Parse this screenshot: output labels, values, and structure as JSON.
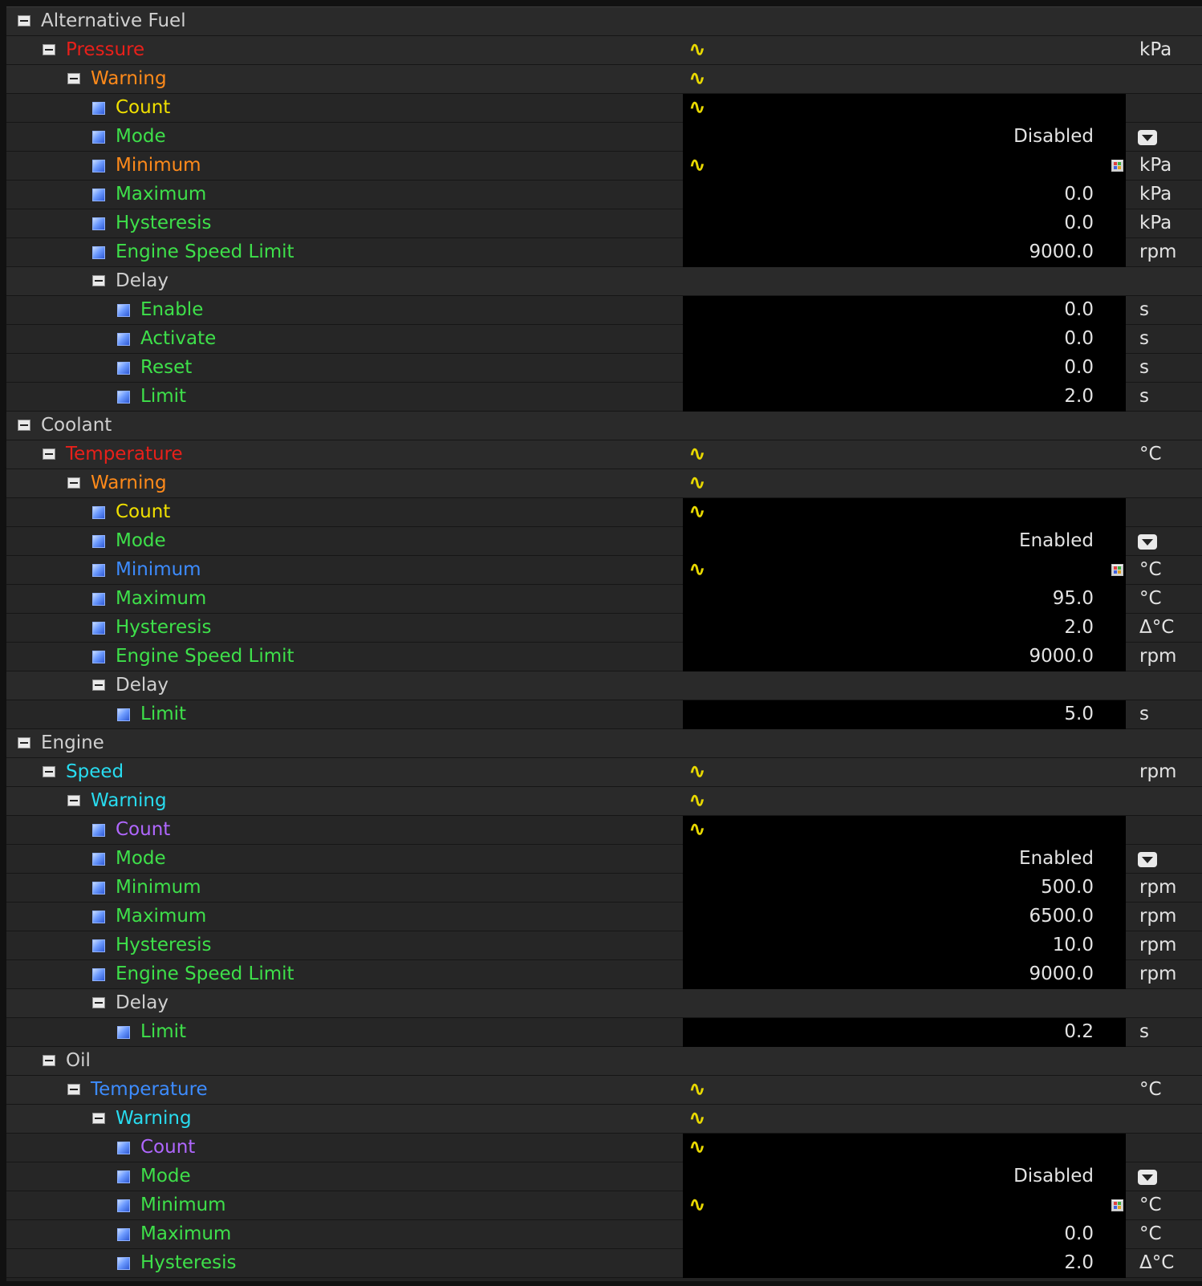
{
  "colors": {
    "red": "#e8201a",
    "orange": "#ff8a1a",
    "yellow": "#f0e000",
    "green": "#3ee04a",
    "blue": "#3d8cff",
    "cyan": "#28dcf0",
    "purple": "#b067ff",
    "gray": "#d0d0d0"
  },
  "rows": [
    {
      "label": "Alternative Fuel",
      "level": 0,
      "kind": "group",
      "color": "gray"
    },
    {
      "label": "Pressure",
      "level": 1,
      "kind": "group",
      "color": "red",
      "wave": true,
      "unit": "kPa"
    },
    {
      "label": "Warning",
      "level": 2,
      "kind": "group",
      "color": "orange",
      "wave": true
    },
    {
      "label": "Count",
      "level": 3,
      "kind": "leaf",
      "color": "yellow",
      "wave": true
    },
    {
      "label": "Mode",
      "level": 3,
      "kind": "leaf",
      "color": "green",
      "value": "Disabled",
      "dropdown": true
    },
    {
      "label": "Minimum",
      "level": 3,
      "kind": "leaf",
      "color": "orange",
      "wave": true,
      "grid": true,
      "unit": "kPa"
    },
    {
      "label": "Maximum",
      "level": 3,
      "kind": "leaf",
      "color": "green",
      "value": "0.0",
      "unit": "kPa"
    },
    {
      "label": "Hysteresis",
      "level": 3,
      "kind": "leaf",
      "color": "green",
      "value": "0.0",
      "unit": "kPa"
    },
    {
      "label": "Engine Speed Limit",
      "level": 3,
      "kind": "leaf",
      "color": "green",
      "value": "9000.0",
      "unit": "rpm"
    },
    {
      "label": "Delay",
      "level": 3,
      "kind": "group",
      "color": "gray"
    },
    {
      "label": "Enable",
      "level": 4,
      "kind": "leaf",
      "color": "green",
      "value": "0.0",
      "unit": "s"
    },
    {
      "label": "Activate",
      "level": 4,
      "kind": "leaf",
      "color": "green",
      "value": "0.0",
      "unit": "s"
    },
    {
      "label": "Reset",
      "level": 4,
      "kind": "leaf",
      "color": "green",
      "value": "0.0",
      "unit": "s"
    },
    {
      "label": "Limit",
      "level": 4,
      "kind": "leaf",
      "color": "green",
      "value": "2.0",
      "unit": "s"
    },
    {
      "label": "Coolant",
      "level": 0,
      "kind": "group",
      "color": "gray"
    },
    {
      "label": "Temperature",
      "level": 1,
      "kind": "group",
      "color": "red",
      "wave": true,
      "unit": "°C"
    },
    {
      "label": "Warning",
      "level": 2,
      "kind": "group",
      "color": "orange",
      "wave": true
    },
    {
      "label": "Count",
      "level": 3,
      "kind": "leaf",
      "color": "yellow",
      "wave": true
    },
    {
      "label": "Mode",
      "level": 3,
      "kind": "leaf",
      "color": "green",
      "value": "Enabled",
      "dropdown": true
    },
    {
      "label": "Minimum",
      "level": 3,
      "kind": "leaf",
      "color": "blue",
      "wave": true,
      "grid": true,
      "unit": "°C"
    },
    {
      "label": "Maximum",
      "level": 3,
      "kind": "leaf",
      "color": "green",
      "value": "95.0",
      "unit": "°C"
    },
    {
      "label": "Hysteresis",
      "level": 3,
      "kind": "leaf",
      "color": "green",
      "value": "2.0",
      "unit": "Δ°C"
    },
    {
      "label": "Engine Speed Limit",
      "level": 3,
      "kind": "leaf",
      "color": "green",
      "value": "9000.0",
      "unit": "rpm"
    },
    {
      "label": "Delay",
      "level": 3,
      "kind": "group",
      "color": "gray"
    },
    {
      "label": "Limit",
      "level": 4,
      "kind": "leaf",
      "color": "green",
      "value": "5.0",
      "unit": "s"
    },
    {
      "label": "Engine",
      "level": 0,
      "kind": "group",
      "color": "gray"
    },
    {
      "label": "Speed",
      "level": 1,
      "kind": "group",
      "color": "cyan",
      "wave": true,
      "unit": "rpm"
    },
    {
      "label": "Warning",
      "level": 2,
      "kind": "group",
      "color": "cyan",
      "wave": true
    },
    {
      "label": "Count",
      "level": 3,
      "kind": "leaf",
      "color": "purple",
      "wave": true
    },
    {
      "label": "Mode",
      "level": 3,
      "kind": "leaf",
      "color": "green",
      "value": "Enabled",
      "dropdown": true
    },
    {
      "label": "Minimum",
      "level": 3,
      "kind": "leaf",
      "color": "green",
      "value": "500.0",
      "unit": "rpm"
    },
    {
      "label": "Maximum",
      "level": 3,
      "kind": "leaf",
      "color": "green",
      "value": "6500.0",
      "unit": "rpm"
    },
    {
      "label": "Hysteresis",
      "level": 3,
      "kind": "leaf",
      "color": "green",
      "value": "10.0",
      "unit": "rpm"
    },
    {
      "label": "Engine Speed Limit",
      "level": 3,
      "kind": "leaf",
      "color": "green",
      "value": "9000.0",
      "unit": "rpm"
    },
    {
      "label": "Delay",
      "level": 3,
      "kind": "group",
      "color": "gray"
    },
    {
      "label": "Limit",
      "level": 4,
      "kind": "leaf",
      "color": "green",
      "value": "0.2",
      "unit": "s"
    },
    {
      "label": "Oil",
      "level": 1,
      "kind": "group",
      "color": "gray"
    },
    {
      "label": "Temperature",
      "level": 2,
      "kind": "group",
      "color": "blue",
      "wave": true,
      "unit": "°C"
    },
    {
      "label": "Warning",
      "level": 3,
      "kind": "group",
      "color": "cyan",
      "wave": true
    },
    {
      "label": "Count",
      "level": 4,
      "kind": "leaf",
      "color": "purple",
      "wave": true
    },
    {
      "label": "Mode",
      "level": 4,
      "kind": "leaf",
      "color": "green",
      "value": "Disabled",
      "dropdown": true
    },
    {
      "label": "Minimum",
      "level": 4,
      "kind": "leaf",
      "color": "green",
      "wave": true,
      "grid": true,
      "unit": "°C"
    },
    {
      "label": "Maximum",
      "level": 4,
      "kind": "leaf",
      "color": "green",
      "value": "0.0",
      "unit": "°C"
    },
    {
      "label": "Hysteresis",
      "level": 4,
      "kind": "leaf",
      "color": "green",
      "value": "2.0",
      "unit": "Δ°C"
    }
  ],
  "icons": {
    "wave": "∿",
    "collapse": "collapse-icon",
    "leaf": "parameter-icon",
    "dropdown": "dropdown-icon",
    "table": "table-icon"
  }
}
